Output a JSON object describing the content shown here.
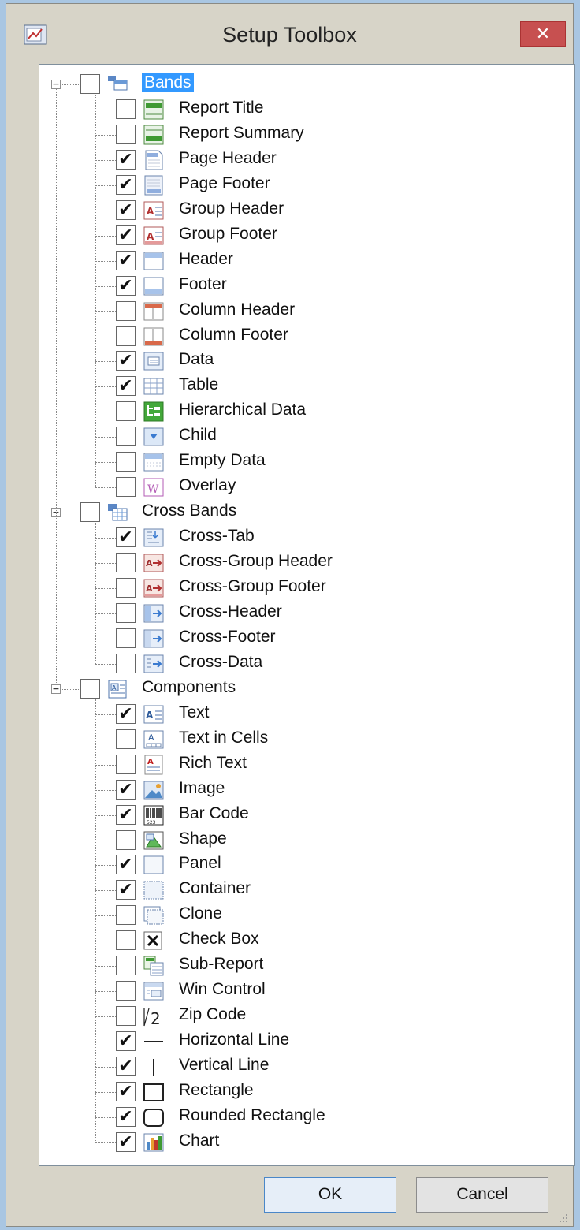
{
  "window": {
    "title": "Setup Toolbox",
    "close_glyph": "✕",
    "icon": "report-app-icon"
  },
  "tree": [
    {
      "type": "group",
      "label": "Bands",
      "checked": false,
      "selected": true,
      "icon": "bands",
      "children": [
        {
          "label": "Report Title",
          "checked": false,
          "icon": "report-title"
        },
        {
          "label": "Report Summary",
          "checked": false,
          "icon": "report-summary"
        },
        {
          "label": "Page Header",
          "checked": true,
          "icon": "page-header"
        },
        {
          "label": "Page Footer",
          "checked": true,
          "icon": "page-footer"
        },
        {
          "label": "Group Header",
          "checked": true,
          "icon": "group-header"
        },
        {
          "label": "Group Footer",
          "checked": true,
          "icon": "group-footer"
        },
        {
          "label": "Header",
          "checked": true,
          "icon": "header"
        },
        {
          "label": "Footer",
          "checked": true,
          "icon": "footer"
        },
        {
          "label": "Column Header",
          "checked": false,
          "icon": "column-header"
        },
        {
          "label": "Column Footer",
          "checked": false,
          "icon": "column-footer"
        },
        {
          "label": "Data",
          "checked": true,
          "icon": "data"
        },
        {
          "label": "Table",
          "checked": true,
          "icon": "table"
        },
        {
          "label": "Hierarchical Data",
          "checked": false,
          "icon": "hierarchical-data"
        },
        {
          "label": "Child",
          "checked": false,
          "icon": "child"
        },
        {
          "label": "Empty Data",
          "checked": false,
          "icon": "empty-data"
        },
        {
          "label": "Overlay",
          "checked": false,
          "icon": "overlay"
        }
      ]
    },
    {
      "type": "group",
      "label": "Cross Bands",
      "checked": false,
      "selected": false,
      "icon": "cross-bands",
      "children": [
        {
          "label": "Cross-Tab",
          "checked": true,
          "icon": "cross-tab"
        },
        {
          "label": "Cross-Group Header",
          "checked": false,
          "icon": "cross-group-header"
        },
        {
          "label": "Cross-Group Footer",
          "checked": false,
          "icon": "cross-group-footer"
        },
        {
          "label": "Cross-Header",
          "checked": false,
          "icon": "cross-header"
        },
        {
          "label": "Cross-Footer",
          "checked": false,
          "icon": "cross-footer"
        },
        {
          "label": "Cross-Data",
          "checked": false,
          "icon": "cross-data"
        }
      ]
    },
    {
      "type": "group",
      "label": "Components",
      "checked": false,
      "selected": false,
      "icon": "components",
      "children": [
        {
          "label": "Text",
          "checked": true,
          "icon": "text"
        },
        {
          "label": "Text in Cells",
          "checked": false,
          "icon": "text-in-cells"
        },
        {
          "label": "Rich Text",
          "checked": false,
          "icon": "rich-text"
        },
        {
          "label": "Image",
          "checked": true,
          "icon": "image"
        },
        {
          "label": "Bar Code",
          "checked": true,
          "icon": "bar-code"
        },
        {
          "label": "Shape",
          "checked": false,
          "icon": "shape"
        },
        {
          "label": "Panel",
          "checked": true,
          "icon": "panel"
        },
        {
          "label": "Container",
          "checked": true,
          "icon": "container"
        },
        {
          "label": "Clone",
          "checked": false,
          "icon": "clone"
        },
        {
          "label": "Check Box",
          "checked": false,
          "icon": "check-box"
        },
        {
          "label": "Sub-Report",
          "checked": false,
          "icon": "sub-report"
        },
        {
          "label": "Win Control",
          "checked": false,
          "icon": "win-control"
        },
        {
          "label": "Zip Code",
          "checked": false,
          "icon": "zip-code"
        },
        {
          "label": "Horizontal Line",
          "checked": true,
          "icon": "horizontal-line"
        },
        {
          "label": "Vertical Line",
          "checked": true,
          "icon": "vertical-line"
        },
        {
          "label": "Rectangle",
          "checked": true,
          "icon": "rectangle"
        },
        {
          "label": "Rounded Rectangle",
          "checked": true,
          "icon": "rounded-rectangle"
        },
        {
          "label": "Chart",
          "checked": true,
          "icon": "chart"
        }
      ]
    }
  ],
  "buttons": {
    "ok": "OK",
    "cancel": "Cancel"
  },
  "glyphs": {
    "check": "✔",
    "expanded": "−"
  },
  "colors": {
    "selection": "#3399ff",
    "close": "#c75050",
    "dialog": "#d7d4c8"
  }
}
